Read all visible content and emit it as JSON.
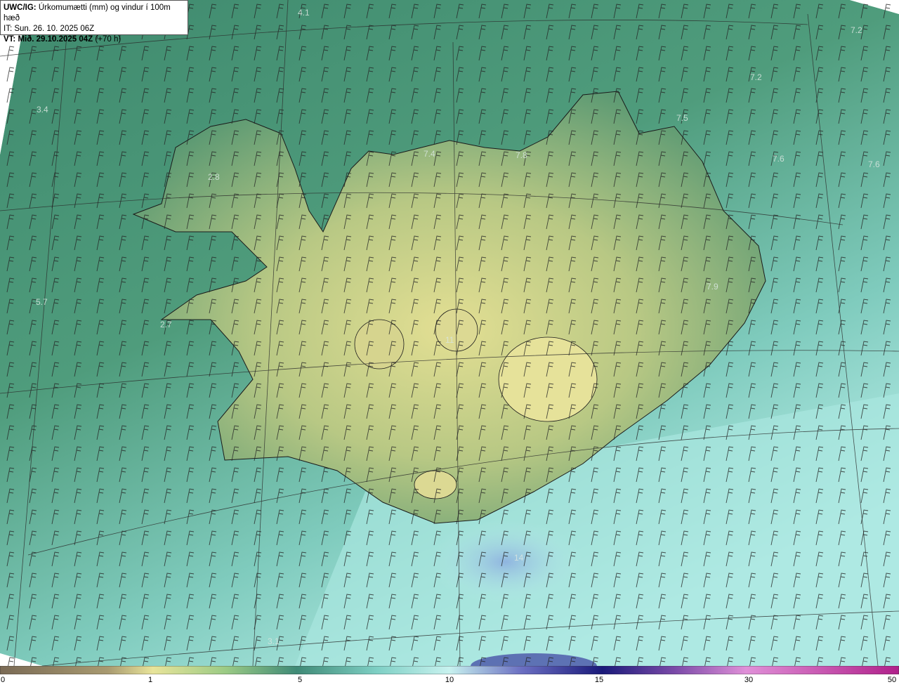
{
  "title": {
    "model": "UWC/IG:",
    "description": "Úrkomumætti (mm) og vindur í 100m hæð",
    "it_line": "IT: Sun. 26. 10. 2025 06Z",
    "vt_label": "VT: Mið. 29.10.2025 04Z",
    "vt_lead": "(+70 h)"
  },
  "value_labels": [
    "4.1",
    "7.2",
    "7.2",
    "3.4",
    "7.5",
    "7.4",
    "7.8",
    "7.6",
    "7.6",
    "2.8",
    "5.7",
    "2.7",
    "11",
    "7.9",
    "3.1",
    "14"
  ],
  "colorbar": {
    "ticks": [
      "0",
      "1",
      "5",
      "10",
      "15",
      "30",
      "50"
    ],
    "colors": [
      "#7a6a55",
      "#a89a70",
      "#e8e49a",
      "#9ccb85",
      "#3f8a76",
      "#7fd0c5",
      "#c8f2ef",
      "#6b6fc2",
      "#1a1a7a",
      "#c878c8",
      "#e090d8",
      "#b0208a"
    ]
  },
  "map_colors": {
    "sea_north": "#3e8a6f",
    "land_low": "#6ea77a",
    "land_high": "#d8d88a",
    "sea_south": "#a6e6e0"
  }
}
